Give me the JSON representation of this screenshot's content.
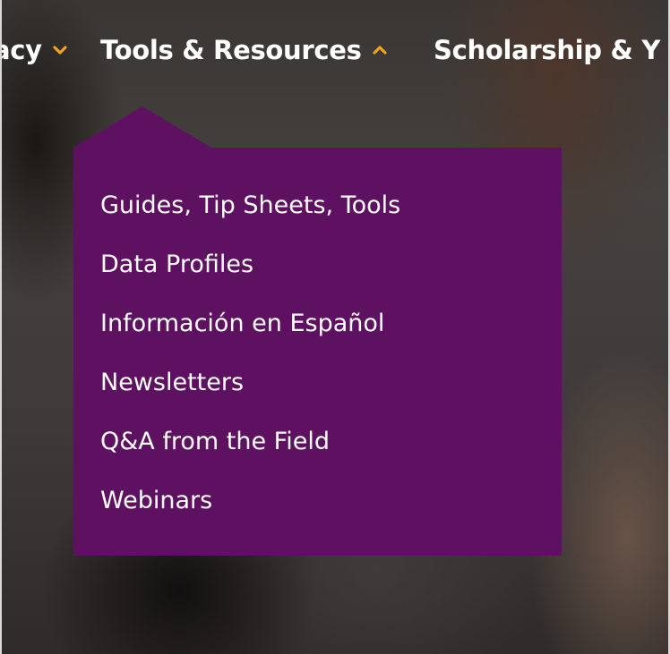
{
  "nav": {
    "items": [
      {
        "label": "acy",
        "icon": "chevron-down-icon"
      },
      {
        "label": "Tools & Resources",
        "icon": "chevron-up-icon"
      },
      {
        "label": "Scholarship & Y",
        "icon": ""
      }
    ],
    "chevron_color": "#f0a31c"
  },
  "dropdown": {
    "background_color": "#5e1160",
    "items": [
      {
        "label": "Guides, Tip Sheets, Tools"
      },
      {
        "label": "Data Profiles"
      },
      {
        "label": "Información en Español"
      },
      {
        "label": "Newsletters"
      },
      {
        "label": "Q&A from the Field"
      },
      {
        "label": "Webinars"
      }
    ]
  }
}
